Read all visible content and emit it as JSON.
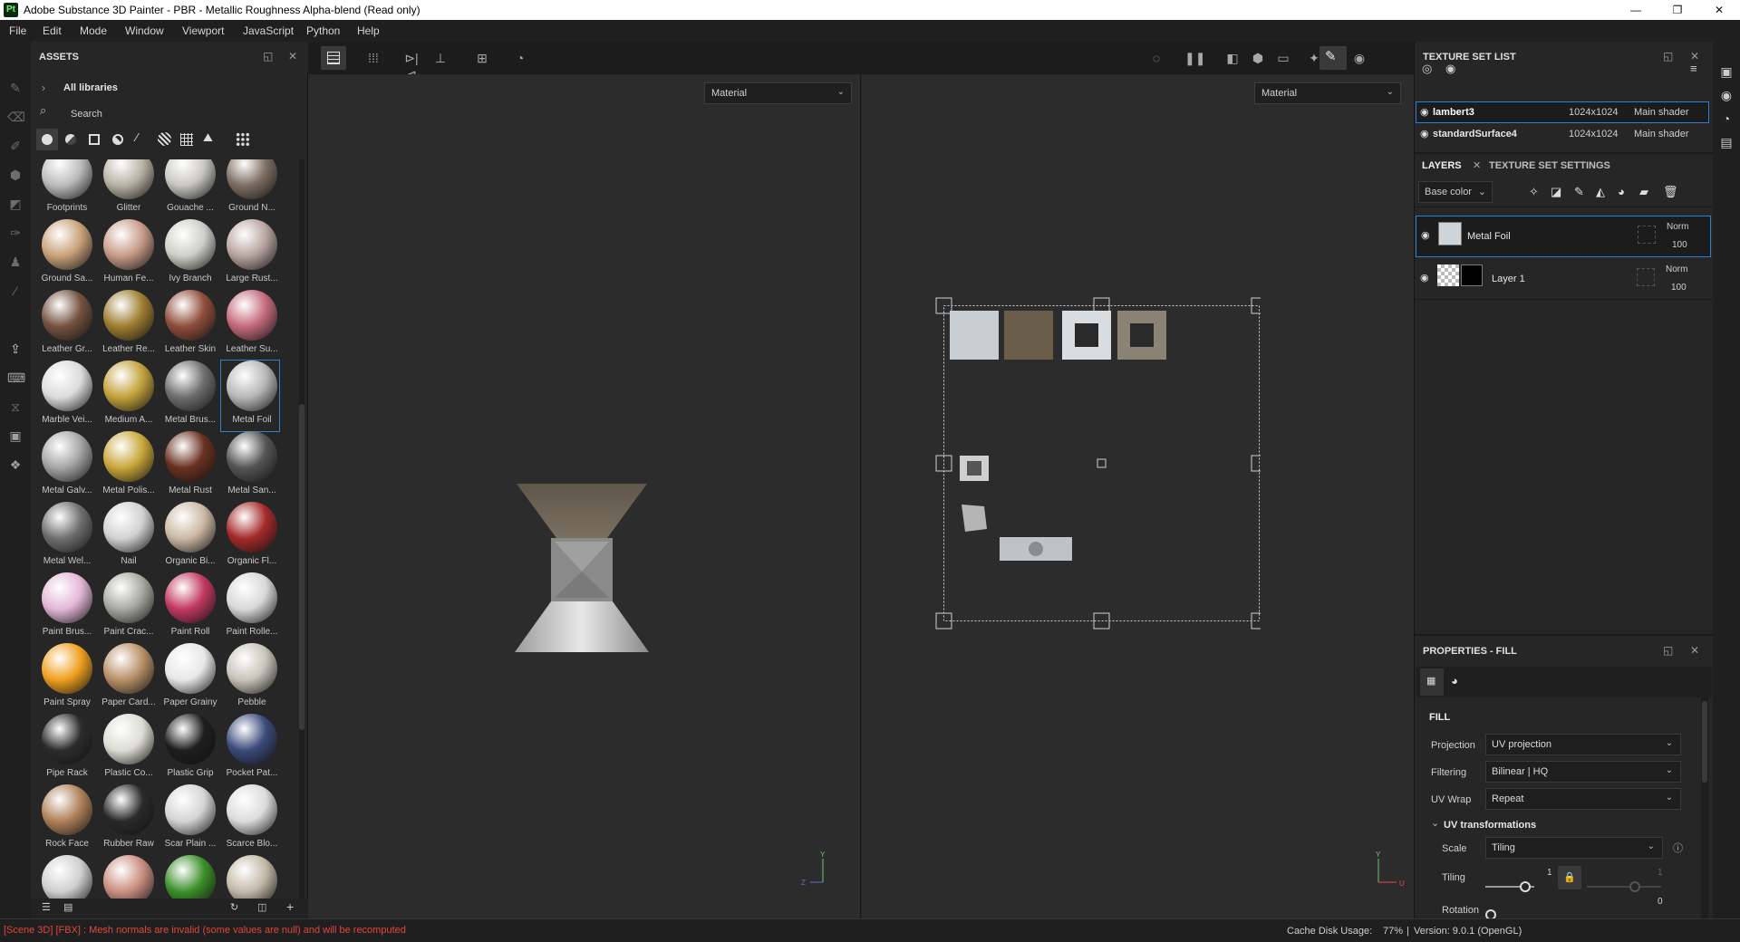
{
  "titlebar": {
    "app_badge": "Pt",
    "title": "Adobe Substance 3D Painter - PBR - Metallic Roughness Alpha-blend (Read only)",
    "minimize": "—",
    "restore": "❐",
    "close": "✕"
  },
  "menu": [
    "File",
    "Edit",
    "Mode",
    "Window",
    "Viewport",
    "JavaScript",
    "Python",
    "Help"
  ],
  "assets": {
    "title": "ASSETS",
    "library": "All libraries",
    "search_placeholder": "Search",
    "materials": [
      {
        "name": "Footprints",
        "color": "#bcbcbc"
      },
      {
        "name": "Glitter",
        "color": "#b9b3a6"
      },
      {
        "name": "Gouache ...",
        "color": "#c9c7c2"
      },
      {
        "name": "Ground N...",
        "color": "#7e6f63"
      },
      {
        "name": "Ground Sa...",
        "color": "#c9a27a"
      },
      {
        "name": "Human Fe...",
        "color": "#c79b88"
      },
      {
        "name": "Ivy Branch",
        "color": "#cfcfc9"
      },
      {
        "name": "Large Rust...",
        "color": "#b9a5a1"
      },
      {
        "name": "Leather Gr...",
        "color": "#74523f"
      },
      {
        "name": "Leather Re...",
        "color": "#9d7d30"
      },
      {
        "name": "Leather Skin",
        "color": "#8f4e3b"
      },
      {
        "name": "Leather Su...",
        "color": "#c46a7b"
      },
      {
        "name": "Marble Vei...",
        "color": "#dcdcdc"
      },
      {
        "name": "Medium A...",
        "color": "#c2a23c"
      },
      {
        "name": "Metal Brus...",
        "color": "#6e6e6e"
      },
      {
        "name": "Metal Foil",
        "color": "#b8b8b8"
      },
      {
        "name": "Metal Galv...",
        "color": "#a5a5a5"
      },
      {
        "name": "Metal Polis...",
        "color": "#c9a73a"
      },
      {
        "name": "Metal Rust",
        "color": "#6a3121"
      },
      {
        "name": "Metal San...",
        "color": "#555555"
      },
      {
        "name": "Metal Wel...",
        "color": "#6f6f6f"
      },
      {
        "name": "Nail",
        "color": "#d2d2d2"
      },
      {
        "name": "Organic Bi...",
        "color": "#cbb8a4"
      },
      {
        "name": "Organic Fl...",
        "color": "#a52a2a"
      },
      {
        "name": "Paint Brus...",
        "color": "#e4b8d8"
      },
      {
        "name": "Paint Crac...",
        "color": "#a9a9a3"
      },
      {
        "name": "Paint Roll",
        "color": "#c23960"
      },
      {
        "name": "Paint Rolle...",
        "color": "#d8d8d8"
      },
      {
        "name": "Paint Spray",
        "color": "#f0a020"
      },
      {
        "name": "Paper Card...",
        "color": "#b99168"
      },
      {
        "name": "Paper Grainy",
        "color": "#e8e8e8"
      },
      {
        "name": "Pebble",
        "color": "#c8c4bb"
      },
      {
        "name": "Pipe Rack",
        "color": "#2c2c2c"
      },
      {
        "name": "Plastic Co...",
        "color": "#ddddd4"
      },
      {
        "name": "Plastic Grip",
        "color": "#1e1e1e"
      },
      {
        "name": "Pocket Pat...",
        "color": "#3a4a7a"
      },
      {
        "name": "Rock Face",
        "color": "#b0825a"
      },
      {
        "name": "Rubber Raw",
        "color": "#2a2a2a"
      },
      {
        "name": "Scar Plain ...",
        "color": "#d5d5d5"
      },
      {
        "name": "Scarce Blo...",
        "color": "#dcdcdc"
      },
      {
        "name": "",
        "color": "#cfcfcf"
      },
      {
        "name": "",
        "color": "#c98f80"
      },
      {
        "name": "",
        "color": "#3b8f2a"
      },
      {
        "name": "",
        "color": "#c2b9a8"
      }
    ],
    "selected": "Metal Foil"
  },
  "viewport": {
    "left_mode": "Material",
    "right_mode": "Material",
    "axis_left": {
      "y": "Y",
      "z": "Z"
    },
    "axis_right": {
      "y": "Y",
      "u": "U"
    }
  },
  "texture_set_list": {
    "title": "TEXTURE SET LIST",
    "rows": [
      {
        "name": "lambert3",
        "res": "1024x1024",
        "shader": "Main shader"
      },
      {
        "name": "standardSurface4",
        "res": "1024x1024",
        "shader": "Main shader"
      }
    ]
  },
  "layers": {
    "tab_layers": "LAYERS",
    "tab_tss": "TEXTURE SET SETTINGS",
    "channel": "Base color",
    "items": [
      {
        "name": "Metal Foil",
        "blend": "Norm",
        "opacity": "100"
      },
      {
        "name": "Layer 1",
        "blend": "Norm",
        "opacity": "100"
      }
    ]
  },
  "properties": {
    "title": "PROPERTIES - FILL",
    "section": "FILL",
    "projection_label": "Projection",
    "projection_value": "UV projection",
    "filtering_label": "Filtering",
    "filtering_value": "Bilinear | HQ",
    "uvwrap_label": "UV Wrap",
    "uvwrap_value": "Repeat",
    "uvtrans": "UV transformations",
    "scale_label": "Scale",
    "scale_value": "Tiling",
    "tiling_label": "Tiling",
    "tiling_value": "1",
    "tiling_value2": "1",
    "rotation_label": "Rotation",
    "rotation_value": "0"
  },
  "status": {
    "error": "[Scene 3D] [FBX] : Mesh normals are invalid (some values are null) and will be recomputed",
    "cache": "Cache Disk Usage:",
    "cache_value": "77%",
    "version": "Version: 9.0.1 (OpenGL)"
  },
  "colors": {
    "accent": "#2d7fd0",
    "error": "#e0473c"
  }
}
